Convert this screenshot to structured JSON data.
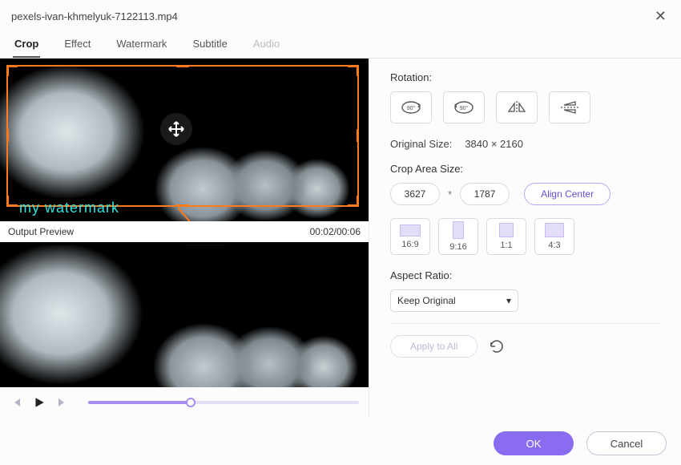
{
  "title": "pexels-ivan-khmelyuk-7122113.mp4",
  "tabs": {
    "crop": "Crop",
    "effect": "Effect",
    "watermark": "Watermark",
    "subtitle": "Subtitle",
    "audio": "Audio"
  },
  "preview": {
    "watermark_text": "my watermark",
    "output_label": "Output Preview",
    "time": "00:02/00:06"
  },
  "rotation": {
    "label": "Rotation:",
    "cw": "90°",
    "ccw": "90°"
  },
  "original": {
    "label": "Original Size:",
    "value": "3840 × 2160"
  },
  "croparea": {
    "label": "Crop Area Size:",
    "w": "3627",
    "h": "1787",
    "times": "*",
    "align": "Align Center"
  },
  "ratios": {
    "r0": "16:9",
    "r1": "9:16",
    "r2": "1:1",
    "r3": "4:3"
  },
  "aspect": {
    "label": "Aspect Ratio:",
    "selected": "Keep Original"
  },
  "apply": "Apply to All",
  "footer": {
    "ok": "OK",
    "cancel": "Cancel"
  }
}
